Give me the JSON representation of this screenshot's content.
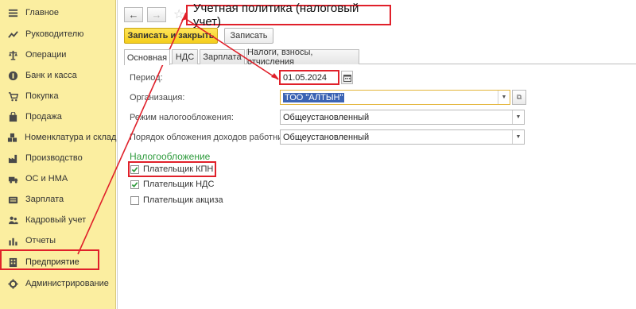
{
  "sidebar": {
    "items": [
      {
        "label": "Главное",
        "icon": "menu-icon"
      },
      {
        "label": "Руководителю",
        "icon": "trend-icon"
      },
      {
        "label": "Операции",
        "icon": "balance-icon"
      },
      {
        "label": "Банк и касса",
        "icon": "coin-icon"
      },
      {
        "label": "Покупка",
        "icon": "cart-icon"
      },
      {
        "label": "Продажа",
        "icon": "bag-icon"
      },
      {
        "label": "Номенклатура и склад",
        "icon": "boxes-icon"
      },
      {
        "label": "Производство",
        "icon": "factory-icon"
      },
      {
        "label": "ОС и НМА",
        "icon": "truck-icon"
      },
      {
        "label": "Зарплата",
        "icon": "wallet-icon"
      },
      {
        "label": "Кадровый учет",
        "icon": "people-icon"
      },
      {
        "label": "Отчеты",
        "icon": "chart-icon"
      },
      {
        "label": "Предприятие",
        "icon": "building-icon"
      },
      {
        "label": "Администрирование",
        "icon": "gear-icon"
      }
    ]
  },
  "header": {
    "back_label": "←",
    "forward_label": "→",
    "title": "Учетная политика (налоговый учет)"
  },
  "toolbar": {
    "save_close_label": "Записать и закрыть",
    "save_label": "Записать"
  },
  "tabs": [
    {
      "label": "Основная"
    },
    {
      "label": "НДС"
    },
    {
      "label": "Зарплата"
    },
    {
      "label": "Налоги, взносы, отчисления"
    }
  ],
  "form": {
    "period_label": "Период:",
    "period_value": "01.05.2024",
    "org_label": "Организация:",
    "org_value": "ТОО \"АЛТЫН\"",
    "tax_regime_label": "Режим налогообложения:",
    "tax_regime_value": "Общеустановленный",
    "income_tax_label": "Порядок обложения доходов работников:",
    "income_tax_value": "Общеустановленный"
  },
  "taxation": {
    "section_title": "Налогообложение",
    "checkboxes": [
      {
        "label": "Плательщик КПН",
        "checked": true
      },
      {
        "label": "Плательщик НДС",
        "checked": true
      },
      {
        "label": "Плательщик акциза",
        "checked": false
      }
    ]
  },
  "colors": {
    "sidebar_bg": "#fbeea0",
    "primary_button": "#f4cd1b",
    "section_green": "#2d9a3b",
    "annotation_red": "#e0202a",
    "selection_blue": "#3c64b4"
  }
}
